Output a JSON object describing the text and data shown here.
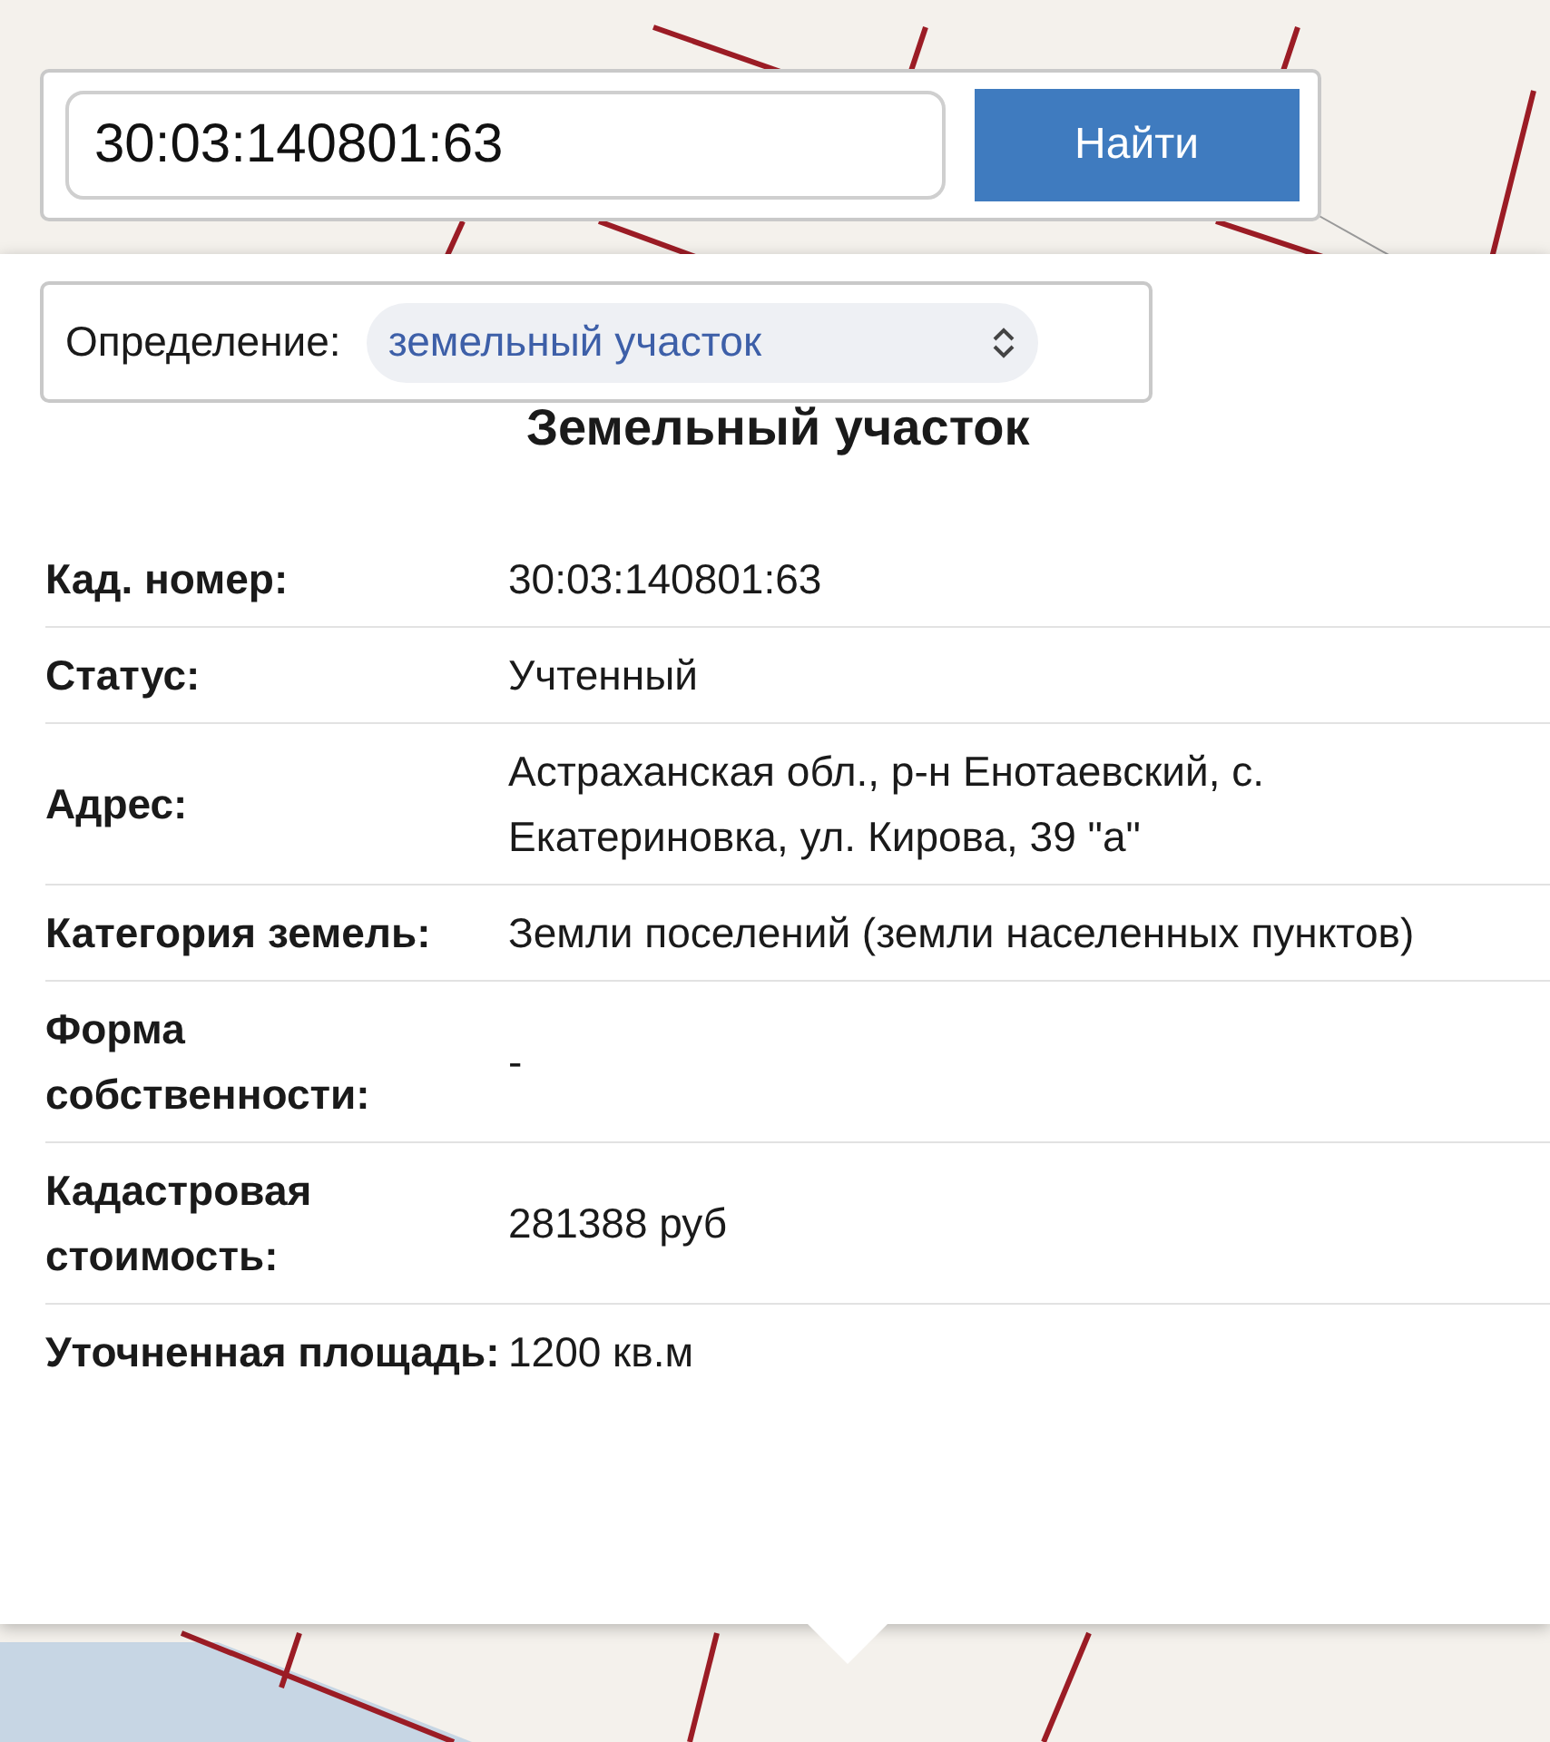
{
  "search": {
    "value": "30:03:140801:63",
    "button": "Найти"
  },
  "definition": {
    "label": "Определение:",
    "value": "земельный участок"
  },
  "popup": {
    "title": "Земельный участок",
    "rows": [
      {
        "label": "Кад. номер:",
        "value": "30:03:140801:63"
      },
      {
        "label": "Статус:",
        "value": "Учтенный"
      },
      {
        "label": "Адрес:",
        "value": "Астраханская обл., р-н Енотаевский, с. Екатериновка, ул. Кирова, 39 \"а\""
      },
      {
        "label": "Категория земель:",
        "value": "Земли поселений (земли населенных пунктов)"
      },
      {
        "label": "Форма собственности:",
        "value": "-"
      },
      {
        "label": "Кадастровая стоимость:",
        "value": "281388 руб"
      },
      {
        "label": "Уточненная площадь:",
        "value": "1200 кв.м"
      }
    ]
  }
}
